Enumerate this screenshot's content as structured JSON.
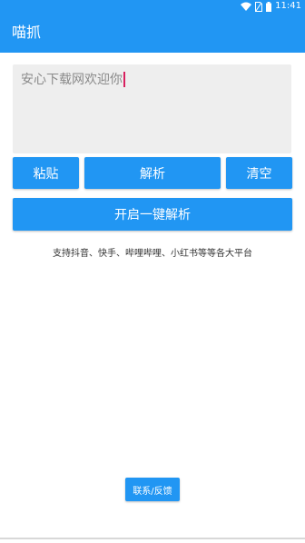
{
  "status_bar": {
    "time": "11:41",
    "icons": [
      "wifi-icon",
      "no-sim-icon",
      "battery-icon"
    ]
  },
  "app_bar": {
    "title": "喵抓"
  },
  "input": {
    "value": "安心下载网欢迎你"
  },
  "buttons": {
    "paste": "粘贴",
    "parse": "解析",
    "clear": "清空",
    "one_click": "开启一键解析",
    "contact": "联系/反馈"
  },
  "support_text": "支持抖音、快手、哔哩哔哩、小红书等等各大平台",
  "colors": {
    "primary": "#2196f3",
    "input_bg": "#eeeeee",
    "caret": "#d8205f"
  }
}
